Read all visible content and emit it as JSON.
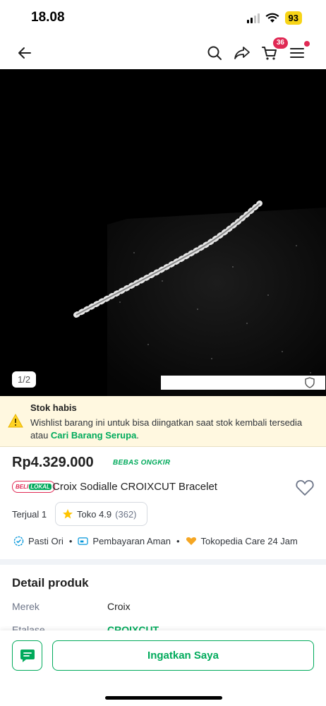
{
  "status": {
    "time": "18.08",
    "battery": "93"
  },
  "nav": {
    "cart_count": "36"
  },
  "image": {
    "counter": "1/2"
  },
  "stock": {
    "title": "Stok habis",
    "desc": "Wishlist barang ini untuk bisa diingatkan saat stok kembali tersedia atau ",
    "link": "Cari Barang Serupa",
    "suffix": "."
  },
  "product": {
    "price": "Rp4.329.000",
    "shipping_badge": "BEBAS ONGKIR",
    "badge_beli": "BELI",
    "badge_lokal": "LOKAL",
    "name": "Croix Sodialle CROIXCUT Bracelet",
    "sold": "Terjual 1",
    "rating_label": "Toko 4.9",
    "rating_count": "(362)"
  },
  "features": [
    "Pasti Ori",
    "Pembayaran Aman",
    "Tokopedia Care 24 Jam"
  ],
  "detail": {
    "title": "Detail produk",
    "rows": [
      {
        "label": "Merek",
        "value": "Croix"
      },
      {
        "label": "Etalase",
        "value": "CROIXCUT"
      }
    ]
  },
  "actions": {
    "remind": "Ingatkan Saya"
  },
  "colors": {
    "green": "#00aa5b",
    "red": "#e02954",
    "banner": "#fff8e0"
  }
}
